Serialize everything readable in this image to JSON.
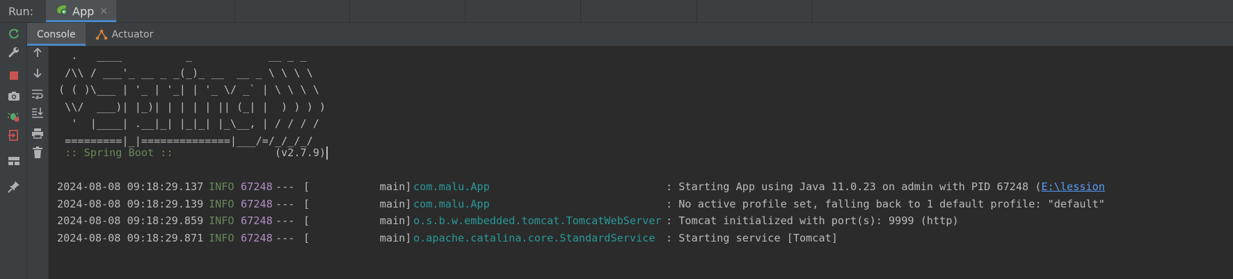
{
  "run_bar": {
    "label": "Run:",
    "tab": {
      "label": "App",
      "icon": "spring-boot-app-icon",
      "close": "×"
    }
  },
  "sub_tabs": [
    {
      "label": "Console",
      "active": true,
      "icon": ""
    },
    {
      "label": "Actuator",
      "active": false,
      "icon": "actuator-icon"
    }
  ],
  "outer_tools": [
    "rerun-icon",
    "wrench-icon",
    "stop-icon",
    "camera-icon",
    "debug-restore-icon",
    "exit-icon",
    "layout-icon",
    "pin-icon"
  ],
  "inner_tools": [
    "up-arrow-icon",
    "down-arrow-icon",
    "soft-wrap-icon",
    "scroll-to-end-icon",
    "print-icon",
    "trash-icon"
  ],
  "console": {
    "banner": "  .   ____          _            __ _ _\n /\\\\ / ___'_ __ _ _(_)_ __  __ _ \\ \\ \\ \\\n( ( )\\___ | '_ | '_| | '_ \\/ _` | \\ \\ \\ \\\n \\\\/  ___)| |_)| | | | | || (_| |  ) ) ) )\n  '  |____| .__|_| |_|_| |_\\__, | / / / /\n =========|_|==============|___/=/_/_/_/",
    "boot_label": " :: Spring Boot :: ",
    "boot_version": "               (v2.7.9)",
    "logs": [
      {
        "ts": "2024-08-08 09:18:29.137",
        "level": "INFO",
        "pid": "67248",
        "sep": "---",
        "thread": "[           main]",
        "logger": "com.malu.App",
        "msg": ": Starting App using Java 11.0.23 on admin with PID 67248 (",
        "link": "E:\\lession"
      },
      {
        "ts": "2024-08-08 09:18:29.139",
        "level": "INFO",
        "pid": "67248",
        "sep": "---",
        "thread": "[           main]",
        "logger": "com.malu.App",
        "msg": ": No active profile set, falling back to 1 default profile: \"default\"",
        "link": ""
      },
      {
        "ts": "2024-08-08 09:18:29.859",
        "level": "INFO",
        "pid": "67248",
        "sep": "---",
        "thread": "[           main]",
        "logger": "o.s.b.w.embedded.tomcat.TomcatWebServer",
        "msg": ": Tomcat initialized with port(s): 9999 (http)",
        "link": ""
      },
      {
        "ts": "2024-08-08 09:18:29.871",
        "level": "INFO",
        "pid": "67248",
        "sep": "---",
        "thread": "[           main]",
        "logger": "o.apache.catalina.core.StandardService",
        "msg": ": Starting service [Tomcat]",
        "link": ""
      }
    ]
  },
  "colors": {
    "background": "#2b2b2b",
    "panel": "#3c3f41",
    "accent": "#4a88c7",
    "info": "#6a8759",
    "pid": "#b28ec6",
    "logger": "#299999",
    "link": "#589df6"
  }
}
